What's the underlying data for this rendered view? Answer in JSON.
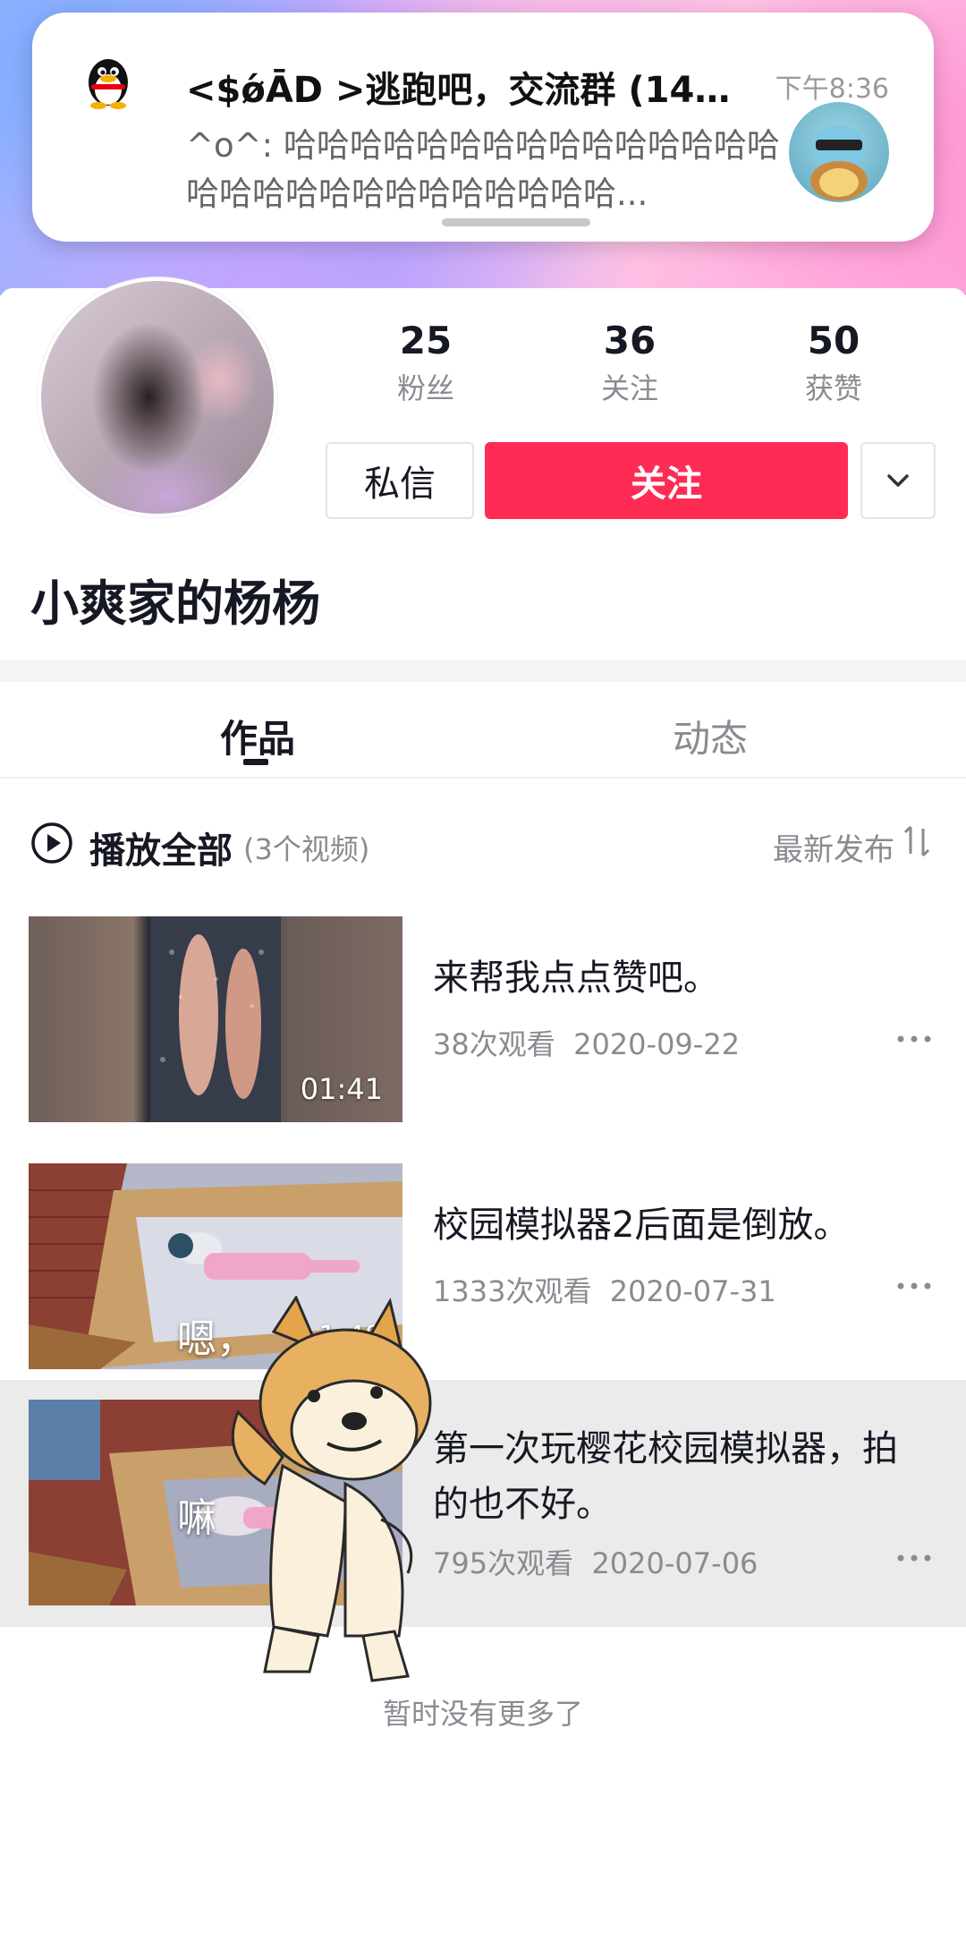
{
  "notification": {
    "title": "<$ǿĀD >逃跑吧，交流群 (14条 ··",
    "time": "下午8:36",
    "message": "^o^: 哈哈哈哈哈哈哈哈哈哈哈哈哈哈哈哈哈哈哈哈哈哈哈哈哈哈哈哈..."
  },
  "profile": {
    "stats": [
      {
        "num": "25",
        "label": "粉丝"
      },
      {
        "num": "36",
        "label": "关注"
      },
      {
        "num": "50",
        "label": "获赞"
      }
    ],
    "message_button": "私信",
    "follow_button": "关注",
    "nickname": "小爽家的杨杨"
  },
  "tabs": {
    "works": "作品",
    "dynamics": "动态"
  },
  "play_all": {
    "label": "播放全部",
    "count": "(3个视频)",
    "sort": "最新发布"
  },
  "videos": [
    {
      "title": "来帮我点点赞吧。",
      "views": "38次观看",
      "date": "2020-09-22",
      "duration": "01:41"
    },
    {
      "title": "校园模拟器2后面是倒放。",
      "views": "1333次观看",
      "date": "2020-07-31",
      "duration": "1:48",
      "caption": "嗯，"
    },
    {
      "title": "第一次玩樱花校园模拟器，拍的也不好。",
      "views": "795次观看",
      "date": "2020-07-06",
      "caption": "嘛"
    }
  ],
  "no_more": "暂时没有更多了",
  "colors": {
    "accent": "#fe2c55",
    "text": "#161823",
    "muted": "#8a8b91"
  }
}
